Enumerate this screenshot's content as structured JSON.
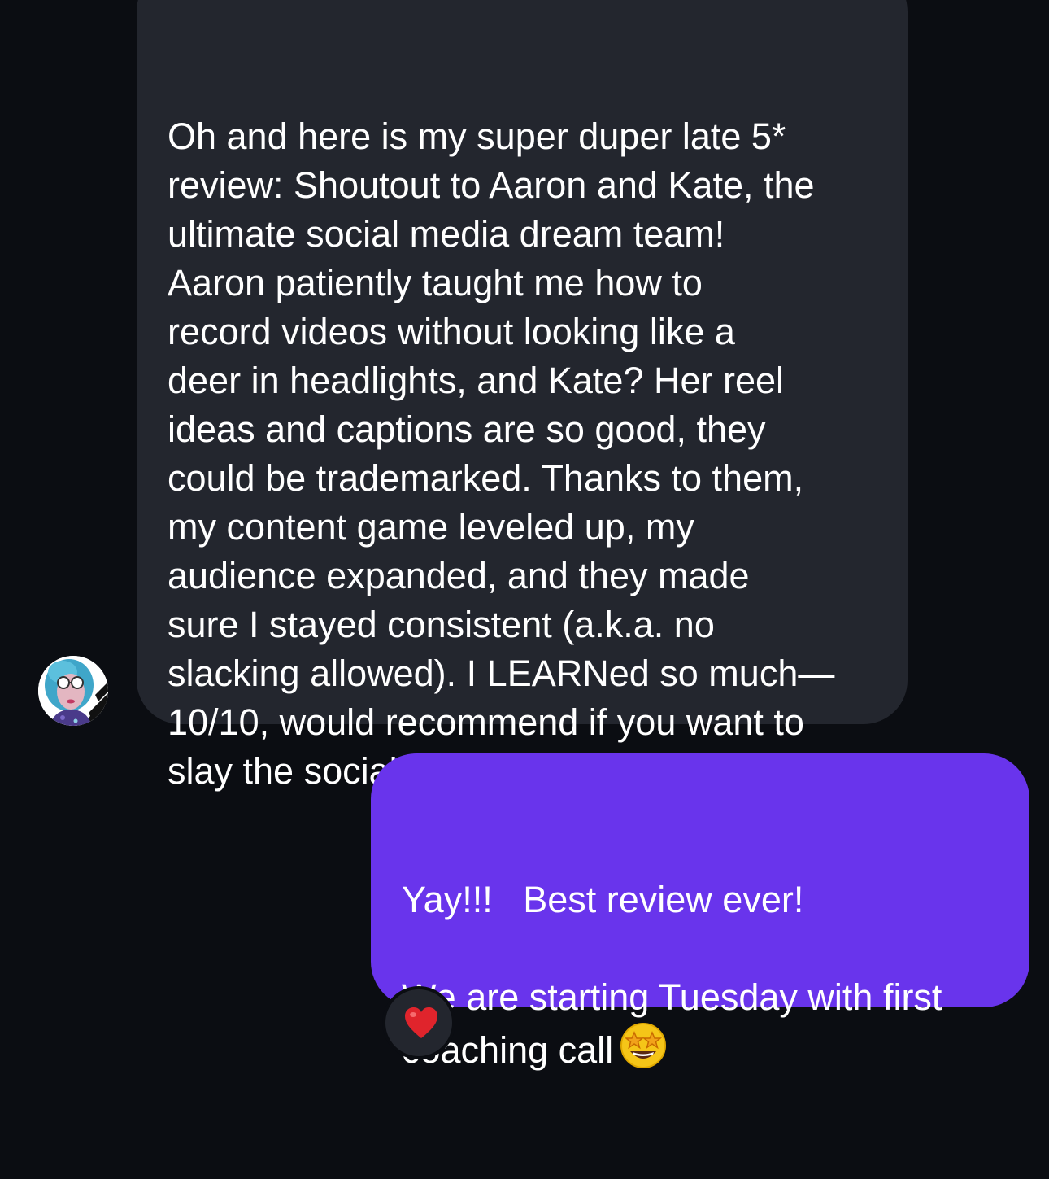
{
  "thread": {
    "incoming": {
      "text": "Oh and here is my super duper late 5*\nreview: Shoutout to Aaron and Kate, the\nultimate social media dream team!\nAaron patiently taught me how to\nrecord videos without looking like a\ndeer in headlights, and Kate? Her reel\nideas and captions are so good, they\ncould be trademarked. Thanks to them,\nmy content game leveled up, my\naudience expanded, and they made\nsure I stayed consistent (a.k.a. no\nslacking allowed). I LEARNed so much—\n10/10, would recommend if you want to\nslay the socials!",
      "avatar_icon": "user-avatar-photo"
    },
    "outgoing": {
      "text": "Yay!!!   Best review ever!\n\nWe are starting Tuesday with first\ncoaching call",
      "emoji_icon": "star-struck-emoji-icon",
      "reaction_icon": "red-heart-icon"
    },
    "colors": {
      "background": "#0b0d12",
      "incoming_bubble": "#23262e",
      "outgoing_bubble": "#6934ec",
      "text": "#ffffff",
      "reaction_heart": "#e0242c"
    }
  }
}
